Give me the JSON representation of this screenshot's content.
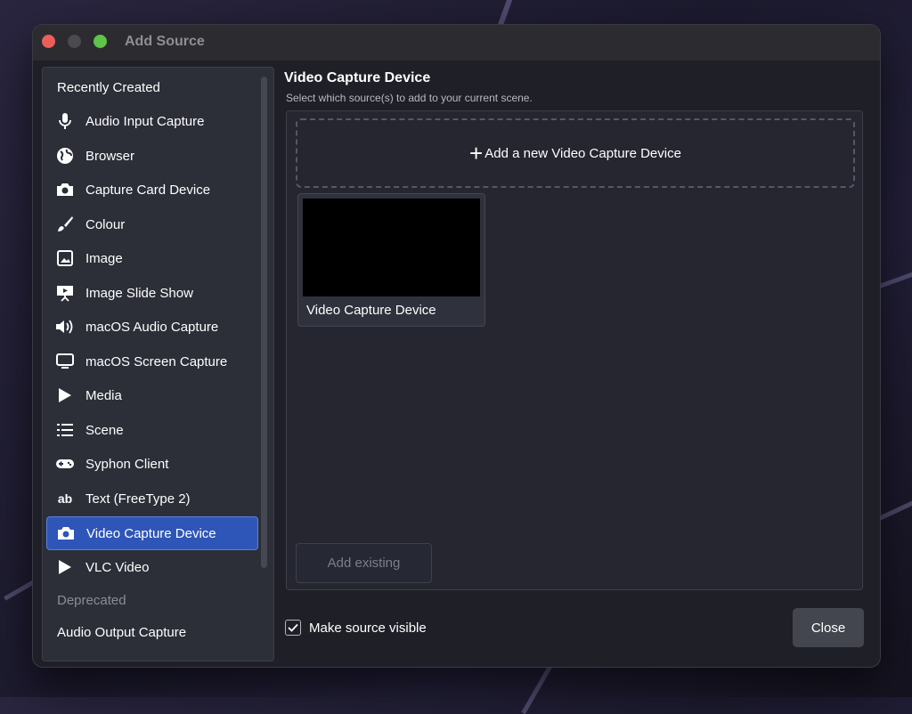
{
  "window": {
    "title": "Add Source"
  },
  "sidebar": {
    "recent_header": "Recently Created",
    "items": [
      {
        "label": "Audio Input Capture",
        "icon": "microphone-icon"
      },
      {
        "label": "Browser",
        "icon": "globe-icon"
      },
      {
        "label": "Capture Card Device",
        "icon": "camera-icon"
      },
      {
        "label": "Colour",
        "icon": "paintbrush-icon"
      },
      {
        "label": "Image",
        "icon": "image-icon"
      },
      {
        "label": "Image Slide Show",
        "icon": "slideshow-icon"
      },
      {
        "label": "macOS Audio Capture",
        "icon": "speaker-icon"
      },
      {
        "label": "macOS Screen Capture",
        "icon": "monitor-icon"
      },
      {
        "label": "Media",
        "icon": "play-icon"
      },
      {
        "label": "Scene",
        "icon": "list-icon"
      },
      {
        "label": "Syphon Client",
        "icon": "gamepad-icon"
      },
      {
        "label": "Text (FreeType 2)",
        "icon": "text-icon"
      },
      {
        "label": "Video Capture Device",
        "icon": "camera-icon",
        "selected": true
      },
      {
        "label": "VLC Video",
        "icon": "play-icon"
      }
    ],
    "deprecated_header": "Deprecated",
    "deprecated_items": [
      {
        "label": "Audio Output Capture"
      }
    ]
  },
  "main": {
    "title": "Video Capture Device",
    "subtitle": "Select which source(s) to add to your current scene.",
    "add_new_label": "Add a new Video Capture Device",
    "existing_sources": [
      {
        "label": "Video Capture Device"
      }
    ],
    "add_existing_label": "Add existing"
  },
  "footer": {
    "visible_label": "Make source visible",
    "visible_checked": true,
    "close_label": "Close"
  },
  "colors": {
    "accent": "#2e55b8",
    "background": "#1f2027"
  }
}
